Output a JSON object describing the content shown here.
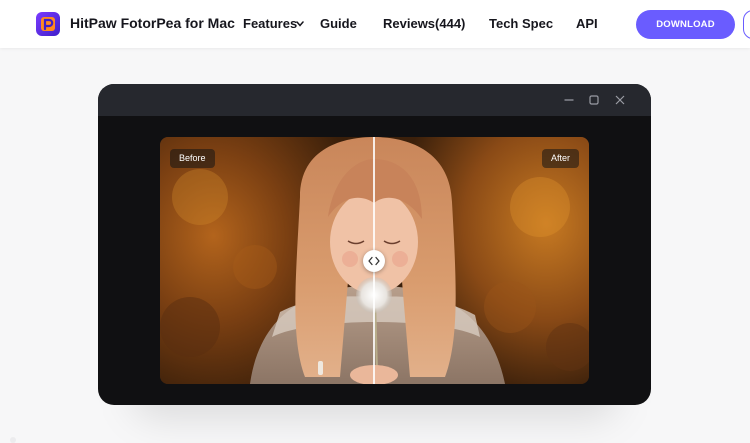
{
  "nav": {
    "brand": "HitPaw FotorPea for Mac",
    "logo_icon": "fotorpea-logo-icon",
    "items": [
      {
        "label": "Features",
        "has_dropdown": true
      },
      {
        "label": "Guide"
      },
      {
        "label": "Reviews(444)"
      },
      {
        "label": "Tech Spec"
      },
      {
        "label": "API"
      }
    ],
    "download_label": "DOWNLOAD",
    "accent_color": "#6a5cff"
  },
  "app_window": {
    "controls": [
      "minimize-icon",
      "maximize-icon",
      "close-icon"
    ],
    "compare": {
      "before_label": "Before",
      "after_label": "After",
      "handle_icon": "compare-arrows-icon",
      "image_description_icon": "girl-blowing-dandelion-photo"
    }
  }
}
